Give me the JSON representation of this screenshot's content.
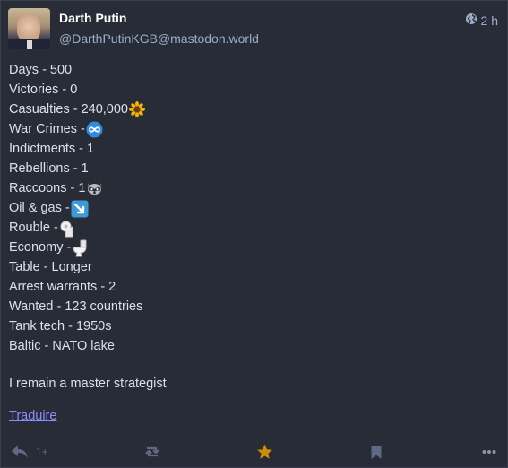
{
  "author": {
    "display_name": "Darth Putin",
    "handle": "@DarthPutinKGB@mastodon.world"
  },
  "meta": {
    "visibility_icon": "globe-icon",
    "time": "2 h"
  },
  "content": {
    "lines": [
      {
        "text": "Days - 500",
        "emoji": ""
      },
      {
        "text": "Victories - 0",
        "emoji": ""
      },
      {
        "text": "Casualties - 240,000",
        "emoji": "sunflower"
      },
      {
        "text": "War Crimes - ",
        "emoji": "infinity"
      },
      {
        "text": "Indictments - 1",
        "emoji": ""
      },
      {
        "text": "Rebellions - 1",
        "emoji": ""
      },
      {
        "text": "Raccoons - 1",
        "emoji": "raccoon"
      },
      {
        "text": "Oil & gas - ",
        "emoji": "arrow-down-right"
      },
      {
        "text": "Rouble - ",
        "emoji": "toilet-paper"
      },
      {
        "text": "Economy - ",
        "emoji": "toilet"
      },
      {
        "text": "Table - Longer",
        "emoji": ""
      },
      {
        "text": "Arrest warrants - 2",
        "emoji": ""
      },
      {
        "text": "Wanted - 123 countries",
        "emoji": ""
      },
      {
        "text": "Tank tech - 1950s",
        "emoji": ""
      },
      {
        "text": "Baltic - NATO lake",
        "emoji": ""
      }
    ],
    "closing": "I remain a master strategist",
    "translate_label": "Traduire"
  },
  "actions": {
    "reply_count": "1+",
    "icons": [
      "reply-icon",
      "boost-icon",
      "favourite-icon",
      "bookmark-icon",
      "more-icon"
    ],
    "favourite_color": "#ca8f04"
  },
  "colors": {
    "background": "#282c37",
    "link": "#8c8dff",
    "muted": "#9baec8"
  }
}
